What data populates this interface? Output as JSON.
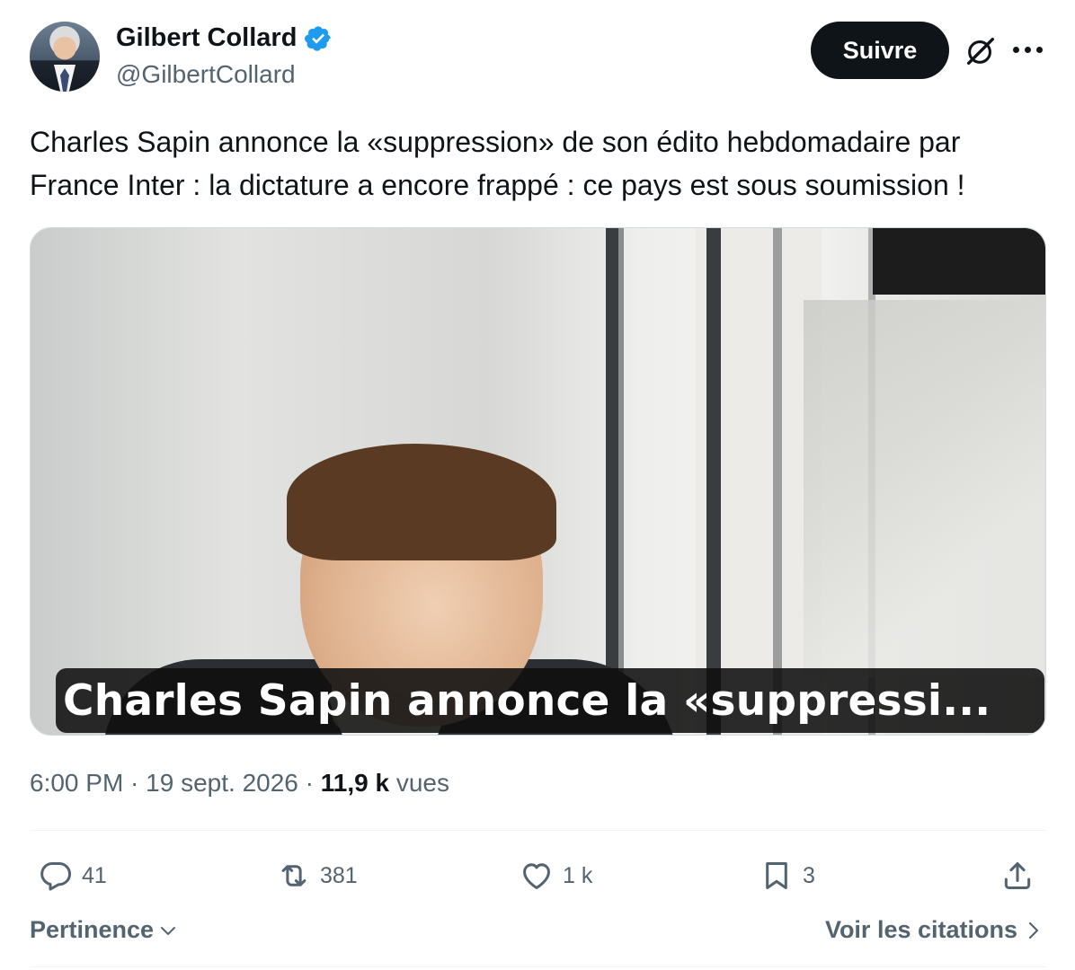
{
  "author": {
    "name": "Gilbert Collard",
    "handle": "@GilbertCollard",
    "verified": true
  },
  "follow_label": "Suivre",
  "tweet_text": "Charles Sapin annonce la «suppression» de son édito hebdomadaire par France Inter : la dictature a encore frappé : ce pays est sous soumission !",
  "media": {
    "caption": "Charles Sapin annonce la «suppressi..."
  },
  "meta": {
    "time": "6:00 PM",
    "separator": " · ",
    "date": "19 sept. 2026",
    "views_count": "11,9 k",
    "views_label": " vues"
  },
  "actions": {
    "replies": "41",
    "reposts": "381",
    "likes": "1 k",
    "bookmarks": "3"
  },
  "footer": {
    "sort_label": "Pertinence",
    "quotes_label": "Voir les citations"
  },
  "colors": {
    "text_primary": "#0f1419",
    "text_secondary": "#536471",
    "verified_blue": "#1d9bf0",
    "button_bg": "#0f1419"
  }
}
